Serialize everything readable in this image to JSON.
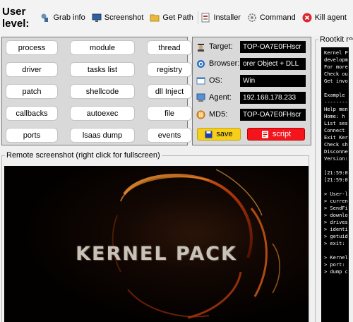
{
  "toolbar": {
    "user_level_label": "User level:",
    "items": [
      {
        "label": "Grab info",
        "icon": "grab-info-icon"
      },
      {
        "label": "Screenshot",
        "icon": "monitor-icon"
      },
      {
        "label": "Get Path",
        "icon": "folder-icon"
      },
      {
        "label": "Installer",
        "icon": "installer-icon"
      },
      {
        "label": "Command",
        "icon": "gear-icon"
      },
      {
        "label": "Kill agent",
        "icon": "kill-icon"
      }
    ]
  },
  "commands": [
    "process",
    "module",
    "thread",
    "driver",
    "tasks list",
    "registry",
    "patch",
    "shellcode",
    "dll Inject",
    "callbacks",
    "autoexec",
    "file",
    "ports",
    "lsaas dump",
    "events"
  ],
  "info": {
    "target_label": "Target:",
    "target_value": "TOP-OA7E0FHscr",
    "browser_label": "Browser:",
    "browser_value": "orer Object + DLL",
    "os_label": "OS:",
    "os_value": "Win",
    "agent_label": "Agent:",
    "agent_value": "192.168.178.233",
    "md5_label": "MD5:",
    "md5_value": "TOP-OA7E0FHscr",
    "save_label": "save",
    "script_label": "script"
  },
  "rootkit": {
    "title": "Rootkit rem",
    "console_lines": [
      "Kernel P",
      "developm",
      "For more",
      "Check ou",
      "Get invo",
      "",
      "Example",
      "--------",
      "Help men",
      "Home: h",
      "List ses",
      "Connect",
      "Exit Ker",
      "Check sh",
      "Disconne",
      "Version:",
      "",
      "[21:59:0",
      "[21:59:0",
      "",
      "> User-l",
      "> curren",
      "> SendFi",
      "> downlo",
      "> drives",
      "> identi",
      "> getuid",
      "> exit:",
      "",
      "> Kernel",
      "> port:",
      "> dump c"
    ]
  },
  "screenshot": {
    "title": "Remote screenshot (right click for fullscreen)",
    "logo_text": "KERNEL PACK"
  },
  "colors": {
    "save_bg": "#f6cf1c",
    "script_bg": "#f3141c",
    "console_bg": "#000000"
  }
}
